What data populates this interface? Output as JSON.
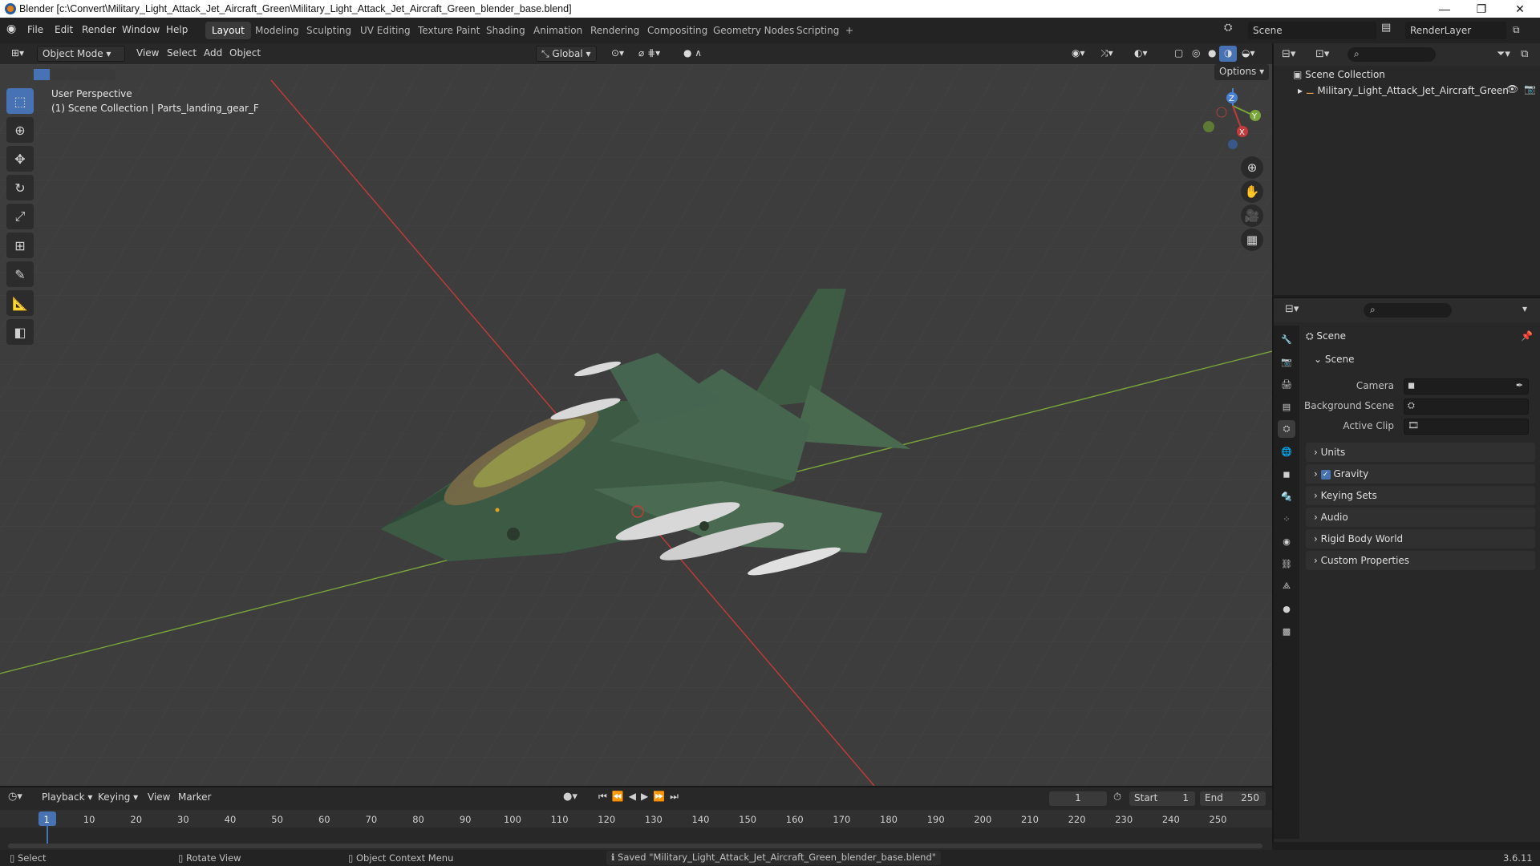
{
  "window": {
    "title": "Blender [c:\\Convert\\Military_Light_Attack_Jet_Aircraft_Green\\Military_Light_Attack_Jet_Aircraft_Green_blender_base.blend]",
    "minimize": "—",
    "maximize": "❐",
    "close": "✕"
  },
  "menu": [
    "File",
    "Edit",
    "Render",
    "Window",
    "Help"
  ],
  "workspaces": [
    "Layout",
    "Modeling",
    "Sculpting",
    "UV Editing",
    "Texture Paint",
    "Shading",
    "Animation",
    "Rendering",
    "Compositing",
    "Geometry Nodes",
    "Scripting",
    "+"
  ],
  "scene_selector": {
    "name": "Scene",
    "renderlayer": "RenderLayer"
  },
  "viewport_header": {
    "mode": "Object Mode",
    "menus": [
      "View",
      "Select",
      "Add",
      "Object"
    ],
    "orientation": "Global",
    "options": "Options"
  },
  "viewport": {
    "perspective": "User Perspective",
    "collection": "(1) Scene Collection | Parts_landing_gear_F",
    "gizmo": {
      "x": "X",
      "y": "Y",
      "z": "Z"
    }
  },
  "outliner": {
    "root": "Scene Collection",
    "item": "Military_Light_Attack_Jet_Aircraft_Green"
  },
  "properties": {
    "header": "Scene",
    "panel": "Scene",
    "camera_label": "Camera",
    "background_label": "Background Scene",
    "clip_label": "Active Clip",
    "sections": [
      "Units",
      "Gravity",
      "Keying Sets",
      "Audio",
      "Rigid Body World",
      "Custom Properties"
    ],
    "gravity_checked": true
  },
  "timeline": {
    "menus": [
      "Playback",
      "Keying",
      "View",
      "Marker"
    ],
    "current_frame": "1",
    "start_label": "Start",
    "start": "1",
    "end_label": "End",
    "end": "250",
    "ticks": [
      "1",
      "10",
      "20",
      "30",
      "40",
      "50",
      "60",
      "70",
      "80",
      "90",
      "100",
      "110",
      "120",
      "130",
      "140",
      "150",
      "160",
      "170",
      "180",
      "190",
      "200",
      "210",
      "220",
      "230",
      "240",
      "250"
    ]
  },
  "statusbar": {
    "select": "Select",
    "rotate": "Rotate View",
    "context": "Object Context Menu",
    "message": "Saved \"Military_Light_Attack_Jet_Aircraft_Green_blender_base.blend\"",
    "version": "3.6.11"
  },
  "colors": {
    "accent": "#4772b3",
    "x_axis": "#c53a3a",
    "y_axis": "#7aa53a",
    "jet_green": "#3c5a44"
  }
}
